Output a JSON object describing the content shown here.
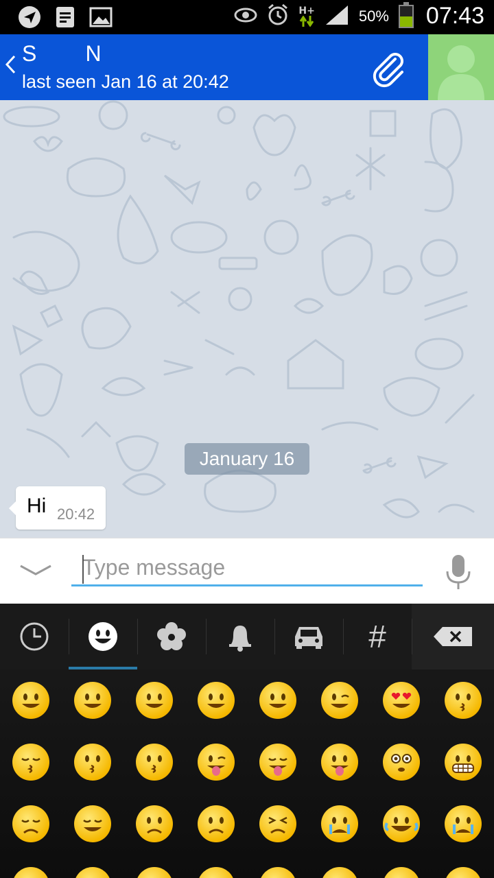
{
  "status_bar": {
    "left_icons": [
      "navigation-icon",
      "notes-icon",
      "image-icon"
    ],
    "right_icons": [
      "eye-icon",
      "alarm-icon",
      "network-hplus-icon",
      "signal-icon"
    ],
    "network_label": "H+",
    "battery_percent": "50%",
    "battery_level": 0.5,
    "time": "07:43"
  },
  "header": {
    "back_icon": "chevron-left-icon",
    "title": "S        N",
    "subtitle": "last seen Jan 16 at 20:42",
    "attach_icon": "paperclip-icon",
    "avatar_icon": "person-silhouette-icon",
    "colors": {
      "bar": "#0a55d8",
      "avatar_bg": "#8ed47a"
    }
  },
  "chat": {
    "date_chip": "January 16",
    "messages": [
      {
        "text": "Hi",
        "time": "20:42",
        "direction": "incoming"
      }
    ]
  },
  "composer": {
    "toggle_icon": "chevron-down-icon",
    "placeholder": "Type message",
    "value": "",
    "mic_icon": "microphone-icon",
    "underline_color": "#4fb0ea"
  },
  "emoji_keyboard": {
    "tabs": [
      {
        "icon": "recent-clock-icon",
        "label": ""
      },
      {
        "icon": "smiley-icon",
        "label": "",
        "active": true
      },
      {
        "icon": "flower-icon",
        "label": ""
      },
      {
        "icon": "bell-icon",
        "label": ""
      },
      {
        "icon": "car-icon",
        "label": ""
      },
      {
        "icon": "symbols-hash-icon",
        "label": "#"
      }
    ],
    "backspace_icon": "backspace-icon",
    "active_color": "#2a7ba8",
    "rows": [
      [
        "grinning-face",
        "smiley-face",
        "smile-face",
        "blush-face",
        "relaxed-face",
        "wink-face",
        "heart-eyes-face",
        "kissing-heart-face"
      ],
      [
        "kissing-closed-eyes-face",
        "kissing-face",
        "kissing-smiling-eyes-face",
        "stuck-out-tongue-winking-eye-face",
        "stuck-out-tongue-closed-eyes-face",
        "stuck-out-tongue-face",
        "flushed-face",
        "grimacing-face"
      ],
      [
        "pensive-face",
        "relieved-face",
        "unamused-face",
        "disappointed-face",
        "persevere-face",
        "cry-face",
        "joy-face",
        "sob-face"
      ],
      [
        "sleepy-face",
        "sleeping-face",
        "cold-sweat-face",
        "sweat-face",
        "fearful-face",
        "confounded-face",
        "scream-face",
        "weary-face"
      ]
    ]
  }
}
